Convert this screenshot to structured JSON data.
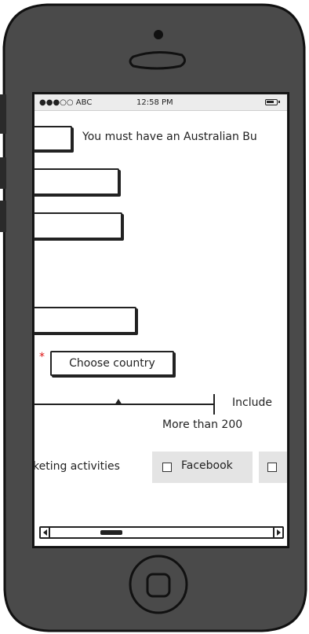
{
  "status_bar": {
    "carrier": "●●●○○ ABC",
    "time": "12:58 PM"
  },
  "form": {
    "abn_note": "You must have an Australian Bu",
    "required_marker": "*",
    "country_button": "Choose country",
    "slider_label": "Include",
    "slider_value_label": "More than 200",
    "marketing_label": "keting activities",
    "checkboxes": [
      {
        "label": "Facebook",
        "checked": false
      },
      {
        "label": "",
        "checked": false
      }
    ]
  },
  "scroll": {
    "position": 0.25
  }
}
